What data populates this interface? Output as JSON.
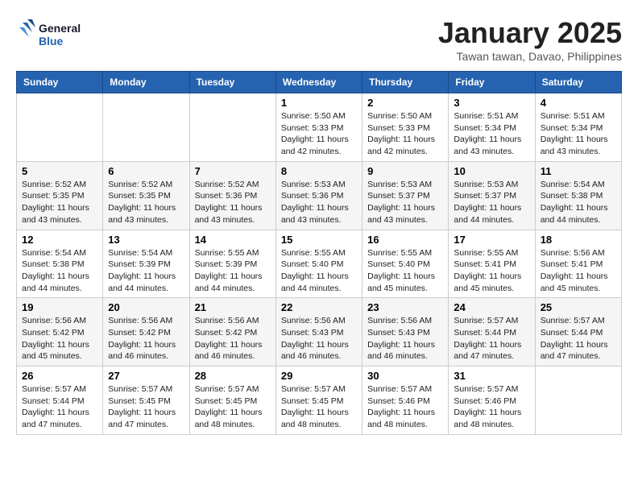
{
  "header": {
    "logo_line1": "General",
    "logo_line2": "Blue",
    "month": "January 2025",
    "location": "Tawan tawan, Davao, Philippines"
  },
  "weekdays": [
    "Sunday",
    "Monday",
    "Tuesday",
    "Wednesday",
    "Thursday",
    "Friday",
    "Saturday"
  ],
  "weeks": [
    [
      {
        "day": "",
        "info": ""
      },
      {
        "day": "",
        "info": ""
      },
      {
        "day": "",
        "info": ""
      },
      {
        "day": "1",
        "info": "Sunrise: 5:50 AM\nSunset: 5:33 PM\nDaylight: 11 hours\nand 42 minutes."
      },
      {
        "day": "2",
        "info": "Sunrise: 5:50 AM\nSunset: 5:33 PM\nDaylight: 11 hours\nand 42 minutes."
      },
      {
        "day": "3",
        "info": "Sunrise: 5:51 AM\nSunset: 5:34 PM\nDaylight: 11 hours\nand 43 minutes."
      },
      {
        "day": "4",
        "info": "Sunrise: 5:51 AM\nSunset: 5:34 PM\nDaylight: 11 hours\nand 43 minutes."
      }
    ],
    [
      {
        "day": "5",
        "info": "Sunrise: 5:52 AM\nSunset: 5:35 PM\nDaylight: 11 hours\nand 43 minutes."
      },
      {
        "day": "6",
        "info": "Sunrise: 5:52 AM\nSunset: 5:35 PM\nDaylight: 11 hours\nand 43 minutes."
      },
      {
        "day": "7",
        "info": "Sunrise: 5:52 AM\nSunset: 5:36 PM\nDaylight: 11 hours\nand 43 minutes."
      },
      {
        "day": "8",
        "info": "Sunrise: 5:53 AM\nSunset: 5:36 PM\nDaylight: 11 hours\nand 43 minutes."
      },
      {
        "day": "9",
        "info": "Sunrise: 5:53 AM\nSunset: 5:37 PM\nDaylight: 11 hours\nand 43 minutes."
      },
      {
        "day": "10",
        "info": "Sunrise: 5:53 AM\nSunset: 5:37 PM\nDaylight: 11 hours\nand 44 minutes."
      },
      {
        "day": "11",
        "info": "Sunrise: 5:54 AM\nSunset: 5:38 PM\nDaylight: 11 hours\nand 44 minutes."
      }
    ],
    [
      {
        "day": "12",
        "info": "Sunrise: 5:54 AM\nSunset: 5:38 PM\nDaylight: 11 hours\nand 44 minutes."
      },
      {
        "day": "13",
        "info": "Sunrise: 5:54 AM\nSunset: 5:39 PM\nDaylight: 11 hours\nand 44 minutes."
      },
      {
        "day": "14",
        "info": "Sunrise: 5:55 AM\nSunset: 5:39 PM\nDaylight: 11 hours\nand 44 minutes."
      },
      {
        "day": "15",
        "info": "Sunrise: 5:55 AM\nSunset: 5:40 PM\nDaylight: 11 hours\nand 44 minutes."
      },
      {
        "day": "16",
        "info": "Sunrise: 5:55 AM\nSunset: 5:40 PM\nDaylight: 11 hours\nand 45 minutes."
      },
      {
        "day": "17",
        "info": "Sunrise: 5:55 AM\nSunset: 5:41 PM\nDaylight: 11 hours\nand 45 minutes."
      },
      {
        "day": "18",
        "info": "Sunrise: 5:56 AM\nSunset: 5:41 PM\nDaylight: 11 hours\nand 45 minutes."
      }
    ],
    [
      {
        "day": "19",
        "info": "Sunrise: 5:56 AM\nSunset: 5:42 PM\nDaylight: 11 hours\nand 45 minutes."
      },
      {
        "day": "20",
        "info": "Sunrise: 5:56 AM\nSunset: 5:42 PM\nDaylight: 11 hours\nand 46 minutes."
      },
      {
        "day": "21",
        "info": "Sunrise: 5:56 AM\nSunset: 5:42 PM\nDaylight: 11 hours\nand 46 minutes."
      },
      {
        "day": "22",
        "info": "Sunrise: 5:56 AM\nSunset: 5:43 PM\nDaylight: 11 hours\nand 46 minutes."
      },
      {
        "day": "23",
        "info": "Sunrise: 5:56 AM\nSunset: 5:43 PM\nDaylight: 11 hours\nand 46 minutes."
      },
      {
        "day": "24",
        "info": "Sunrise: 5:57 AM\nSunset: 5:44 PM\nDaylight: 11 hours\nand 47 minutes."
      },
      {
        "day": "25",
        "info": "Sunrise: 5:57 AM\nSunset: 5:44 PM\nDaylight: 11 hours\nand 47 minutes."
      }
    ],
    [
      {
        "day": "26",
        "info": "Sunrise: 5:57 AM\nSunset: 5:44 PM\nDaylight: 11 hours\nand 47 minutes."
      },
      {
        "day": "27",
        "info": "Sunrise: 5:57 AM\nSunset: 5:45 PM\nDaylight: 11 hours\nand 47 minutes."
      },
      {
        "day": "28",
        "info": "Sunrise: 5:57 AM\nSunset: 5:45 PM\nDaylight: 11 hours\nand 48 minutes."
      },
      {
        "day": "29",
        "info": "Sunrise: 5:57 AM\nSunset: 5:45 PM\nDaylight: 11 hours\nand 48 minutes."
      },
      {
        "day": "30",
        "info": "Sunrise: 5:57 AM\nSunset: 5:46 PM\nDaylight: 11 hours\nand 48 minutes."
      },
      {
        "day": "31",
        "info": "Sunrise: 5:57 AM\nSunset: 5:46 PM\nDaylight: 11 hours\nand 48 minutes."
      },
      {
        "day": "",
        "info": ""
      }
    ]
  ]
}
